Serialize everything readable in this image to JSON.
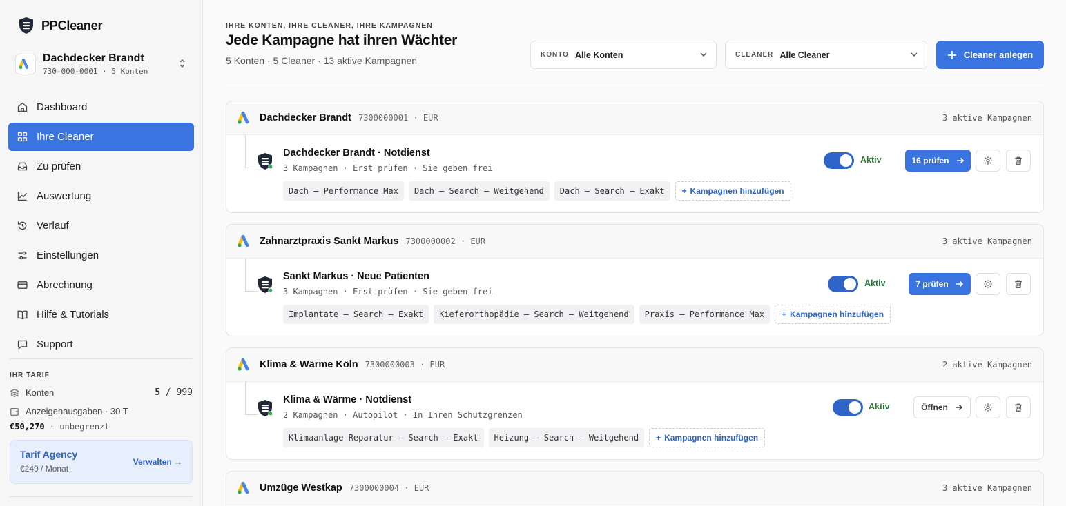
{
  "app": {
    "name": "PPCleaner"
  },
  "account": {
    "name": "Dachdecker Brandt",
    "sub": "730-000-0001 · 5 Konten"
  },
  "nav": [
    {
      "label": "Dashboard",
      "icon": "home-icon",
      "active": false
    },
    {
      "label": "Ihre Cleaner",
      "icon": "grid-icon",
      "active": true
    },
    {
      "label": "Zu prüfen",
      "icon": "inbox-icon",
      "active": false
    },
    {
      "label": "Auswertung",
      "icon": "chart-icon",
      "active": false
    },
    {
      "label": "Verlauf",
      "icon": "history-icon",
      "active": false
    },
    {
      "label": "Einstellungen",
      "icon": "sliders-icon",
      "active": false
    },
    {
      "label": "Abrechnung",
      "icon": "card-icon",
      "active": false
    },
    {
      "label": "Hilfe & Tutorials",
      "icon": "book-icon",
      "active": false
    },
    {
      "label": "Support",
      "icon": "chat-icon",
      "active": false
    }
  ],
  "tarif": {
    "heading": "IHR TARIF",
    "konten_label": "Konten",
    "konten_used": "5",
    "konten_sep": " / ",
    "konten_max": "999",
    "spend_label": "Anzeigenausgaben · 30 T",
    "spend_amount": "€50,270",
    "spend_limit": " · unbegrenzt",
    "plan_name": "Tarif Agency",
    "plan_price": "€249 / Monat",
    "plan_manage": "Verwalten"
  },
  "header": {
    "eyebrow": "IHRE KONTEN, IHRE CLEANER, IHRE KAMPAGNEN",
    "title": "Jede Kampagne hat ihren Wächter",
    "subtitle": "5 Konten · 5 Cleaner · 13 aktive Kampagnen",
    "filter_konto_label": "KONTO",
    "filter_konto_value": "Alle Konten",
    "filter_cleaner_label": "CLEANER",
    "filter_cleaner_value": "Alle Cleaner",
    "create_button": "Cleaner anlegen"
  },
  "cards": [
    {
      "account": "Dachdecker Brandt",
      "meta": "7300000001 · EUR",
      "count": "3 aktive Kampagnen",
      "cleaner": {
        "name": "Dachdecker Brandt · Notdienst",
        "sub": "3 Kampagnen · Erst prüfen · Sie geben frei",
        "status": "Aktiv",
        "action": "16 prüfen",
        "action_type": "check",
        "chips": [
          "Dach — Performance Max",
          "Dach — Search — Weitgehend",
          "Dach — Search — Exakt"
        ],
        "add_label": "Kampagnen hinzufügen"
      }
    },
    {
      "account": "Zahnarztpraxis Sankt Markus",
      "meta": "7300000002 · EUR",
      "count": "3 aktive Kampagnen",
      "cleaner": {
        "name": "Sankt Markus · Neue Patienten",
        "sub": "3 Kampagnen · Erst prüfen · Sie geben frei",
        "status": "Aktiv",
        "action": "7 prüfen",
        "action_type": "check",
        "chips": [
          "Implantate — Search — Exakt",
          "Kieferorthopädie — Search — Weitgehend",
          "Praxis — Performance Max"
        ],
        "add_label": "Kampagnen hinzufügen"
      }
    },
    {
      "account": "Klima & Wärme Köln",
      "meta": "7300000003 · EUR",
      "count": "2 aktive Kampagnen",
      "cleaner": {
        "name": "Klima & Wärme · Notdienst",
        "sub": "2 Kampagnen · Autopilot · In Ihren Schutzgrenzen",
        "status": "Aktiv",
        "action": "Öffnen",
        "action_type": "open",
        "chips": [
          "Klimaanlage Reparatur — Search — Exakt",
          "Heizung — Search — Weitgehend"
        ],
        "add_label": "Kampagnen hinzufügen"
      }
    },
    {
      "account": "Umzüge Westkap",
      "meta": "7300000004 · EUR",
      "count": "3 aktive Kampagnen"
    }
  ],
  "colors": {
    "accent": "#3a74e0",
    "active_green": "#2a7a3a",
    "text_blue": "#2f64c8"
  }
}
